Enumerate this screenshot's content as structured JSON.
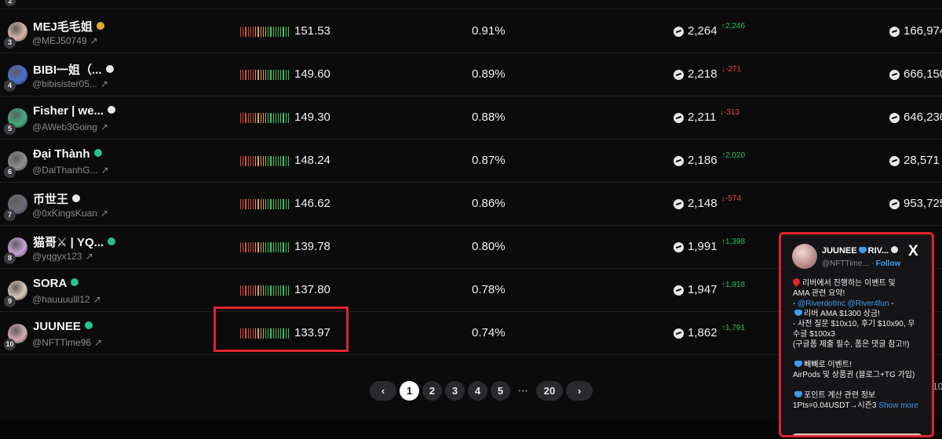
{
  "top_row": {
    "rank": "2"
  },
  "rows": [
    {
      "rank": "3",
      "name": "MEJ毛毛姐",
      "badge": "gold",
      "handle": "@MEJ50749",
      "score": "151.53",
      "pct": "0.91%",
      "balance": "2,264",
      "change": "↑2,246",
      "dir": "up",
      "total": "166,974",
      "avatar": "#d9b8a8",
      "level": 0.55
    },
    {
      "rank": "4",
      "name": "BIBI一姐（...",
      "badge": "white",
      "handle": "@bibisister05...",
      "score": "149.60",
      "pct": "0.89%",
      "balance": "2,218",
      "change": "↓-271",
      "dir": "down",
      "total": "666,150",
      "avatar": "#4a6fd8",
      "level": 0.55
    },
    {
      "rank": "5",
      "name": "Fisher | we...",
      "badge": "white",
      "handle": "@AWeb3Going",
      "score": "149.30",
      "pct": "0.88%",
      "balance": "2,211",
      "change": "↓-313",
      "dir": "down",
      "total": "646,230",
      "avatar": "#3fae7c",
      "level": 0.55
    },
    {
      "rank": "6",
      "name": "Đại Thành",
      "badge": "green",
      "handle": "@DaiThanhG...",
      "score": "148.24",
      "pct": "0.87%",
      "balance": "2,186",
      "change": "↑2,020",
      "dir": "up",
      "total": "28,571",
      "avatar": "#8f8f8f",
      "level": 0.55
    },
    {
      "rank": "7",
      "name": "币世王",
      "badge": "white",
      "handle": "@0xKingsKuan",
      "score": "146.62",
      "pct": "0.86%",
      "balance": "2,148",
      "change": "↓-574",
      "dir": "down",
      "total": "953,725",
      "avatar": "#6b6b75",
      "level": 0.55
    },
    {
      "rank": "8",
      "name": "猫哥⚔ | YQ...",
      "badge": "green",
      "handle": "@yqgyx123",
      "score": "139.78",
      "pct": "0.80%",
      "balance": "1,991",
      "change": "↑1,398",
      "dir": "up",
      "total": "",
      "avatar": "#c9a2d8",
      "level": 0.5
    },
    {
      "rank": "9",
      "name": "SORA",
      "badge": "green",
      "handle": "@hauuuulll12",
      "score": "137.80",
      "pct": "0.78%",
      "balance": "1,947",
      "change": "↑1,918",
      "dir": "up",
      "total": "",
      "avatar": "#d8c7b8",
      "level": 0.5
    },
    {
      "rank": "10",
      "name": "JUUNEE",
      "badge": "green",
      "handle": "@NFTTime96",
      "score": "133.97",
      "pct": "0.74%",
      "balance": "1,862",
      "change": "↑1,791",
      "dir": "up",
      "total": "",
      "avatar": "#d5a9b2",
      "level": 0.5
    }
  ],
  "pagination": {
    "prev": "‹",
    "pages": [
      "1",
      "2",
      "3",
      "4",
      "5"
    ],
    "ellipsis": "···",
    "last": "20",
    "next": "›",
    "active": "1",
    "edge_text": "10"
  },
  "popup": {
    "name": "JUUNEE",
    "name_suffix": "RIV...",
    "handle": "@NFTTime...",
    "separator": " · ",
    "follow": "Follow",
    "x_icon": "X",
    "lines": [
      {
        "t": "리버에서 진행하는 이벤트 및",
        "pin": true
      },
      {
        "t": "AMA 관련 요약!"
      },
      {
        "pre": "- ",
        "link": "@RiverdotInc @River4fun",
        "post": " -"
      },
      {
        "t": "리버 AMA $1300 상금!",
        "wave": true
      },
      {
        "t": "- 사전 질문 $10x10, 후기 $10x90, 우"
      },
      {
        "t": "수글 $100x3"
      },
      {
        "t": "(구글폼 제출 필수, 폼은 댓글 참고!!)"
      },
      {
        "blank": true
      },
      {
        "t": "빼빼로 이벤트!",
        "wave": true
      },
      {
        "t": "AirPods 및 상품권 (블로그+TG 가입)"
      },
      {
        "blank": true
      },
      {
        "t": "포인트 계산 관련 정보",
        "wave": true
      },
      {
        "t": "1Pts=0.04USDT→시즌3",
        "more": "Show more"
      }
    ]
  },
  "colors": {
    "highlight": "#e0242b",
    "up": "#22c55e",
    "down": "#ef4444",
    "link": "#3b9cf0"
  }
}
